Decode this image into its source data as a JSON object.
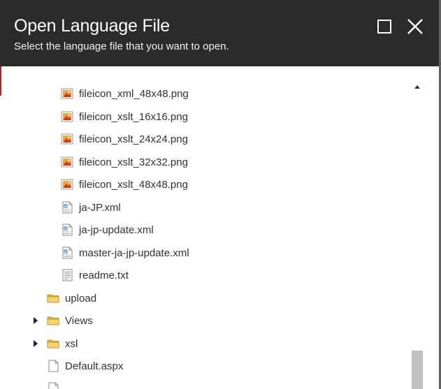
{
  "dialog": {
    "title": "Open Language File",
    "subtitle": "Select the language file that you want to open.",
    "icons": {
      "maximize": "maximize-icon",
      "close": "close-icon"
    }
  },
  "tree": {
    "items": [
      {
        "label": "fileicon_xml_48x48.png",
        "icon": "image-file-icon"
      },
      {
        "label": "fileicon_xslt_16x16.png",
        "icon": "image-file-icon"
      },
      {
        "label": "fileicon_xslt_24x24.png",
        "icon": "image-file-icon"
      },
      {
        "label": "fileicon_xslt_32x32.png",
        "icon": "image-file-icon"
      },
      {
        "label": "fileicon_xslt_48x48.png",
        "icon": "image-file-icon"
      },
      {
        "label": "ja-JP.xml",
        "icon": "xml-file-icon"
      },
      {
        "label": "ja-jp-update.xml",
        "icon": "xml-file-icon"
      },
      {
        "label": "master-ja-jp-update.xml",
        "icon": "xml-file-icon"
      },
      {
        "label": "readme.txt",
        "icon": "text-file-icon"
      },
      {
        "label": "upload",
        "icon": "folder-icon",
        "expandable": false
      },
      {
        "label": "Views",
        "icon": "folder-icon",
        "expandable": true
      },
      {
        "label": "xsl",
        "icon": "folder-icon",
        "expandable": true
      },
      {
        "label": "Default.aspx",
        "icon": "document-icon"
      }
    ]
  },
  "colors": {
    "titlebar": "#2b2b2b",
    "title_text": "#ffffff",
    "item_text": "#333333",
    "folder": "#f4c542",
    "scroll_thumb": "#c1c1c1"
  }
}
